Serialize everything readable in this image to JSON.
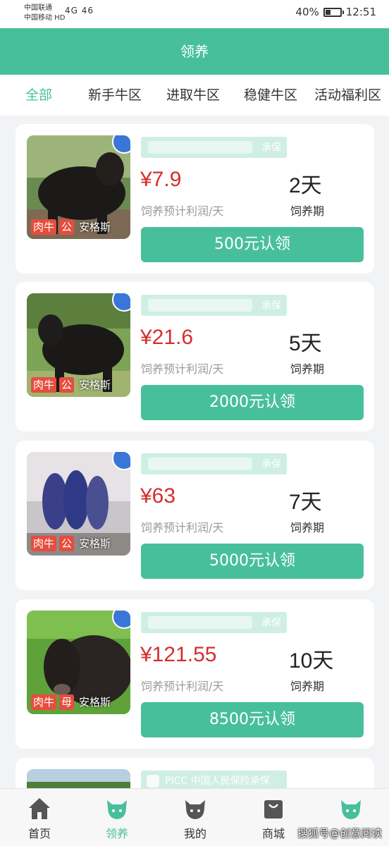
{
  "status_bar": {
    "carrier_1": "中国联通",
    "carrier_2": "中国移动 HD",
    "signal": "4G 46",
    "battery": "40%",
    "battery_level": 0.4,
    "time": "12:51"
  },
  "header": {
    "title": "领养"
  },
  "tabs": [
    {
      "label": "全部",
      "active": true
    },
    {
      "label": "新手牛区",
      "active": false
    },
    {
      "label": "进取牛区",
      "active": false
    },
    {
      "label": "稳健牛区",
      "active": false
    },
    {
      "label": "活动福利区",
      "active": false
    }
  ],
  "cards": [
    {
      "insurance": "承保",
      "price": "¥7.9",
      "price_label": "饲养预计利润/天",
      "days": "2天",
      "days_label": "饲养期",
      "button": "500元认领",
      "tags": [
        "肉牛",
        "公",
        "安格斯"
      ]
    },
    {
      "insurance": "承保",
      "price": "¥21.6",
      "price_label": "饲养预计利润/天",
      "days": "5天",
      "days_label": "饲养期",
      "button": "2000元认领",
      "tags": [
        "肉牛",
        "公",
        "安格斯"
      ]
    },
    {
      "insurance": "承保",
      "price": "¥63",
      "price_label": "饲养预计利润/天",
      "days": "7天",
      "days_label": "饲养期",
      "button": "5000元认领",
      "tags": [
        "肉牛",
        "公",
        "安格斯"
      ]
    },
    {
      "insurance": "承保",
      "price": "¥121.55",
      "price_label": "饲养预计利润/天",
      "days": "10天",
      "days_label": "饲养期",
      "button": "8500元认领",
      "tags": [
        "肉牛",
        "母",
        "安格斯"
      ]
    }
  ],
  "partial_card": {
    "insurance": "PICC 中国人民保险承保"
  },
  "bottom_nav": [
    {
      "label": "首页",
      "icon": "home-icon",
      "active": false
    },
    {
      "label": "领养",
      "icon": "cow-head-icon",
      "active": true
    },
    {
      "label": "我的",
      "icon": "bull-head-icon",
      "active": false
    },
    {
      "label": "商城",
      "icon": "shopping-bag-icon",
      "active": false
    },
    {
      "label": "",
      "icon": "cow-head-icon",
      "active": false
    }
  ],
  "watermark": "搜狐号@创意阅读",
  "colors": {
    "brand": "#48bf9b",
    "price": "#d32f2f",
    "tag": "#e64d3d"
  }
}
